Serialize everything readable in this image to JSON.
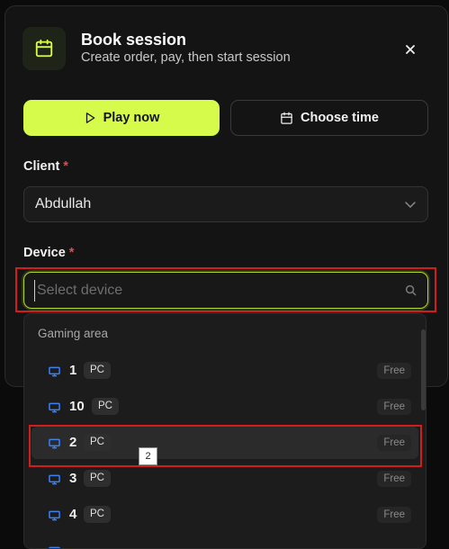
{
  "dialog": {
    "title": "Book session",
    "subtitle": "Create order, pay, then start session",
    "icon": "calendar-icon",
    "accent": "#d6fb4a"
  },
  "actions": {
    "play_label": "Play now",
    "choose_time_label": "Choose time"
  },
  "client": {
    "label": "Client",
    "required_mark": "*",
    "value": "Abdullah"
  },
  "device": {
    "label": "Device",
    "required_mark": "*",
    "placeholder": "Select device"
  },
  "dropdown": {
    "group_label": "Gaming area",
    "items": [
      {
        "name": "1",
        "type": "PC",
        "status": "Free"
      },
      {
        "name": "10",
        "type": "PC",
        "status": "Free"
      },
      {
        "name": "2",
        "type": "PC",
        "status": "Free"
      },
      {
        "name": "3",
        "type": "PC",
        "status": "Free"
      },
      {
        "name": "4",
        "type": "PC",
        "status": "Free"
      }
    ]
  },
  "tooltip": {
    "text": "2"
  }
}
